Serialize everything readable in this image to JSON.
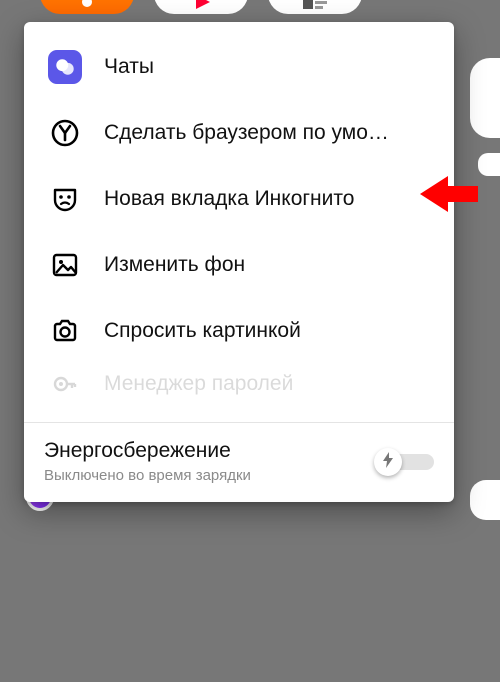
{
  "menu": {
    "items": [
      {
        "key": "chats",
        "label": "Чаты"
      },
      {
        "key": "default-browser",
        "label": "Сделать браузером по умо…"
      },
      {
        "key": "incognito-tab",
        "label": "Новая вкладка Инкогнито"
      },
      {
        "key": "change-background",
        "label": "Изменить фон"
      },
      {
        "key": "ask-with-image",
        "label": "Спросить картинкой"
      },
      {
        "key": "password-manager",
        "label": "Менеджер паролей"
      }
    ]
  },
  "energy": {
    "title": "Энергосбережение",
    "subtitle": "Выключено во время зарядки",
    "enabled": false
  },
  "pointer": {
    "target": "incognito-tab",
    "color": "#ff0000"
  }
}
